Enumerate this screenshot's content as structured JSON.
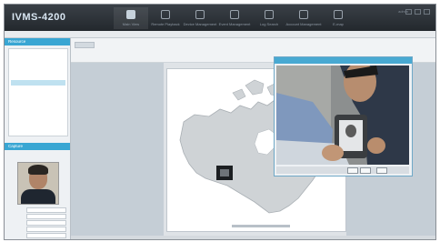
{
  "app": {
    "logo": "IVMS-4200",
    "nav": [
      {
        "label": "Main View",
        "icon": "monitor-icon",
        "active": true
      },
      {
        "label": "Remote Playback",
        "icon": "playback-icon",
        "active": false
      },
      {
        "label": "Device Management",
        "icon": "device-icon",
        "active": false
      },
      {
        "label": "Event Management",
        "icon": "event-icon",
        "active": false
      },
      {
        "label": "Log Search",
        "icon": "log-icon",
        "active": false
      },
      {
        "label": "Account Management",
        "icon": "account-icon",
        "active": false
      },
      {
        "label": "E-map",
        "icon": "map-icon",
        "active": false
      }
    ],
    "user": "admin"
  },
  "left_panel": {
    "header": "Resource",
    "tree": [
      {
        "label": "",
        "selected": false
      },
      {
        "label": "",
        "selected": false
      },
      {
        "label": "",
        "selected": false
      },
      {
        "label": "",
        "selected": false
      },
      {
        "label": "",
        "selected": true
      }
    ],
    "lower_header": "Capture"
  },
  "video_window": {
    "ctrl_label": ""
  },
  "colors": {
    "accent": "#39a6d3",
    "titlebar": "#2a3036",
    "map_fill": "#cfd3d6"
  }
}
